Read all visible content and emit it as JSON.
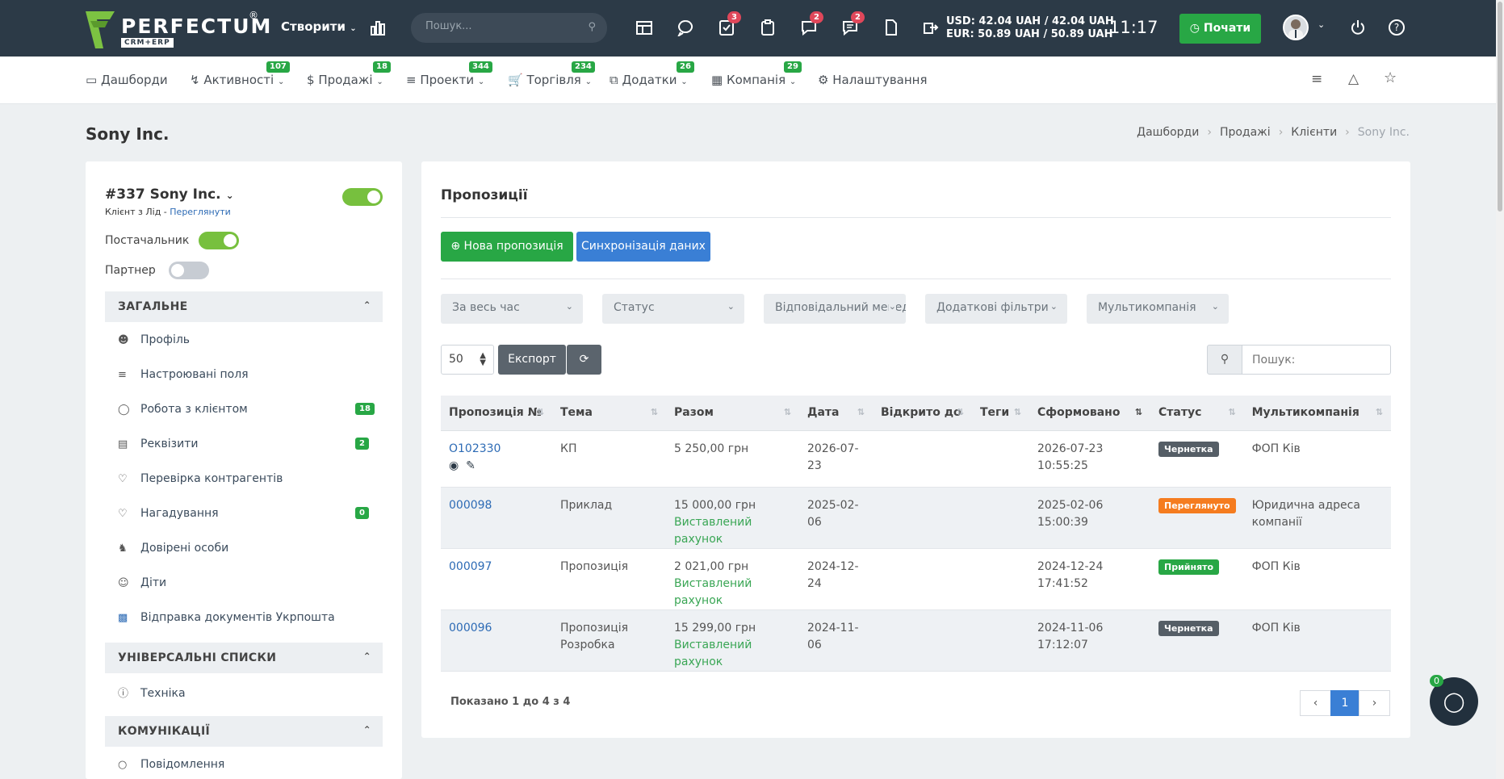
{
  "topbar": {
    "logo_text": "PERFECTUM",
    "logo_sub": "CRM+ERP",
    "logo_reg": "®",
    "create_label": "Створити",
    "search_placeholder": "Пошук...",
    "badges": {
      "tasks": "3",
      "chat": "2",
      "messages": "2"
    },
    "usd_rate": "USD: 42.04 UAH / 42.04 UAH",
    "eur_rate": "EUR: 50.89 UAH / 50.89 UAH",
    "time": "11:17",
    "start_label": "Почати"
  },
  "menu": [
    {
      "label": "Дашборди",
      "badge": ""
    },
    {
      "label": "Активності",
      "badge": "107"
    },
    {
      "label": "Продажі",
      "badge": "18"
    },
    {
      "label": "Проекти",
      "badge": "344"
    },
    {
      "label": "Торгівля",
      "badge": "234"
    },
    {
      "label": "Додатки",
      "badge": "26"
    },
    {
      "label": "Компанія",
      "badge": "29"
    },
    {
      "label": "Налаштування",
      "badge": ""
    }
  ],
  "page": {
    "title": "Sony Inc.",
    "breadcrumbs": [
      "Дашборди",
      "Продажі",
      "Клієнти",
      "Sony Inc."
    ]
  },
  "client": {
    "name": "#337 Sony Inc.",
    "subtitle_prefix": "Клієнт з Лід - ",
    "subtitle_link": "Переглянути",
    "active": true,
    "supplier_label": "Постачальник",
    "partner_label": "Партнер"
  },
  "sidebar": {
    "section_general": "ЗАГАЛЬНЕ",
    "items": [
      {
        "label": "Профіль",
        "badge": ""
      },
      {
        "label": "Настроювані поля",
        "badge": ""
      },
      {
        "label": "Робота з клієнтом",
        "badge": "18"
      },
      {
        "label": "Реквізити",
        "badge": "2"
      },
      {
        "label": "Перевірка контрагентів",
        "badge": ""
      },
      {
        "label": "Нагадування",
        "badge": "0"
      },
      {
        "label": "Довірені особи",
        "badge": ""
      },
      {
        "label": "Діти",
        "badge": ""
      },
      {
        "label": "Відправка документів Укрпошта",
        "badge": ""
      }
    ],
    "section_lists": "УНІВЕРСАЛЬНІ СПИСКИ",
    "lists_items": [
      {
        "label": "Техніка"
      }
    ],
    "section_comms": "КОМУНІКАЦІЇ",
    "comms_items": [
      {
        "label": "Повідомлення"
      }
    ]
  },
  "proposals": {
    "title": "Пропозиції",
    "new_button": "Нова пропозиція",
    "sync_button": "Синхронізація даних",
    "filters": [
      "За весь час",
      "Статус",
      "Відповідальний менеджер",
      "Додаткові фільтри",
      "Мультикомпанія"
    ],
    "page_size": "50",
    "export_label": "Експорт",
    "search_placeholder": "Пошук:",
    "columns": [
      "Пропозиція №",
      "Тема",
      "Разом",
      "Дата",
      "Відкрито до",
      "Теги",
      "Сформовано",
      "Статус",
      "Мультикомпанія"
    ],
    "rows": [
      {
        "number": "O102330",
        "subject": "КП",
        "total": "5 250,00 грн",
        "invoice": "",
        "date": "2026-07-23",
        "open_until": "",
        "tags": "",
        "created": "2026-07-23 10:55:25",
        "status": "Чернетка",
        "status_color": "#555e66",
        "company": "ФОП Ків"
      },
      {
        "number": "000098",
        "subject": "Приклад",
        "total": "15 000,00 грн",
        "invoice": "Виставлений рахунок",
        "date": "2025-02-06",
        "open_until": "",
        "tags": "",
        "created": "2025-02-06 15:00:39",
        "status": "Переглянуто",
        "status_color": "#f57c1f",
        "company": "Юридична адреса компанії"
      },
      {
        "number": "000097",
        "subject": "Пропозиція",
        "total": "2 021,00 грн",
        "invoice": "Виставлений рахунок",
        "date": "2024-12-24",
        "open_until": "",
        "tags": "",
        "created": "2024-12-24 17:41:52",
        "status": "Прийнято",
        "status_color": "#28a745",
        "company": "ФОП Ків"
      },
      {
        "number": "000096",
        "subject": "Пропозиція Розробка",
        "total": "15 299,00 грн",
        "invoice": "Виставлений рахунок",
        "date": "2024-11-06",
        "open_until": "",
        "tags": "",
        "created": "2024-11-06 17:12:07",
        "status": "Чернетка",
        "status_color": "#555e66",
        "company": "ФОП Ків"
      }
    ],
    "summary": "Показано 1 до 4 з 4",
    "current_page": "1"
  },
  "chat_widget": {
    "badge": "0"
  }
}
